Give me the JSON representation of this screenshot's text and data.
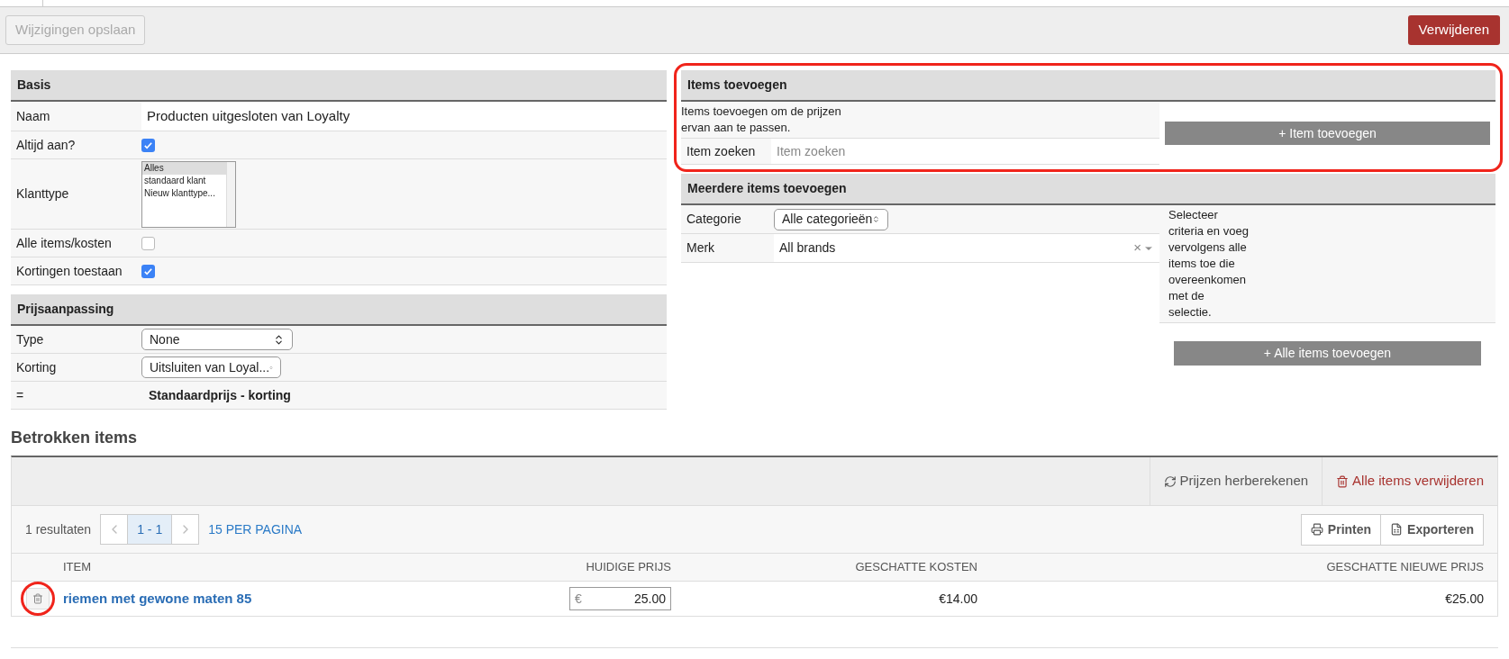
{
  "toolbar": {
    "save_button": {
      "label": "Wijzigingen opslaan",
      "disabled": true
    },
    "delete_button": "Verwijderen"
  },
  "basis": {
    "title": "Basis",
    "rows": [
      {
        "kind": "text",
        "label": "Naam",
        "value": "Producten uitgesloten van Loyalty"
      },
      {
        "kind": "checkbox",
        "label": "Altijd aan?",
        "checked": true
      },
      {
        "kind": "listbox",
        "label": "Klanttype",
        "options": [
          {
            "label": "Alles",
            "selected": true
          },
          {
            "label": "standaard klant",
            "selected": false
          },
          {
            "label": "Nieuw klanttype...",
            "selected": false
          }
        ]
      },
      {
        "kind": "checkbox",
        "label": "Alle items/kosten",
        "checked": false
      },
      {
        "kind": "checkbox",
        "label": "Kortingen toestaan",
        "checked": true
      }
    ]
  },
  "prijsaanpassing": {
    "title": "Prijsaanpassing",
    "rows": [
      {
        "kind": "select",
        "label": "Type",
        "value": "None"
      },
      {
        "kind": "select",
        "label": "Korting",
        "value": "Uitsluiten van Loyal..."
      },
      {
        "kind": "formula",
        "label": "=",
        "value": "Standaardprijs - korting"
      }
    ]
  },
  "items_toevoegen": {
    "title": "Items toevoegen",
    "highlighted": true,
    "description": "Items toevoegen om de prijzen ervan aan te passen.",
    "search_label": "Item zoeken",
    "search_placeholder": "Item zoeken",
    "add_button": "+ Item toevoegen"
  },
  "meerdere": {
    "title": "Meerdere items toevoegen",
    "categorie_label": "Categorie",
    "categorie_value": "Alle categorieën",
    "merk_label": "Merk",
    "merk_value": "All brands",
    "clear": "×",
    "description": "Selecteer criteria en voeg vervolgens alle items toe die overeenkomen met de selectie.",
    "add_all_button": "+ Alle items toevoegen"
  },
  "betrokken": {
    "title": "Betrokken items",
    "recalc_button": "Prijzen herberekenen",
    "delete_all_button": "Alle items verwijderen",
    "results": "1 resultaten",
    "page": "1 - 1",
    "per_page": "15 PER PAGINA",
    "print_button": "Printen",
    "export_button": "Exporteren",
    "columns": [
      "ITEM",
      "HUIDIGE PRIJS",
      "GESCHATTE KOSTEN",
      "GESCHATTE NIEUWE PRIJS"
    ],
    "rows": [
      {
        "item": "riemen met gewone maten 85",
        "currency": "€",
        "price": "25.00",
        "cost": "€14.00",
        "new_price": "€25.00",
        "highlighted": true
      }
    ]
  }
}
